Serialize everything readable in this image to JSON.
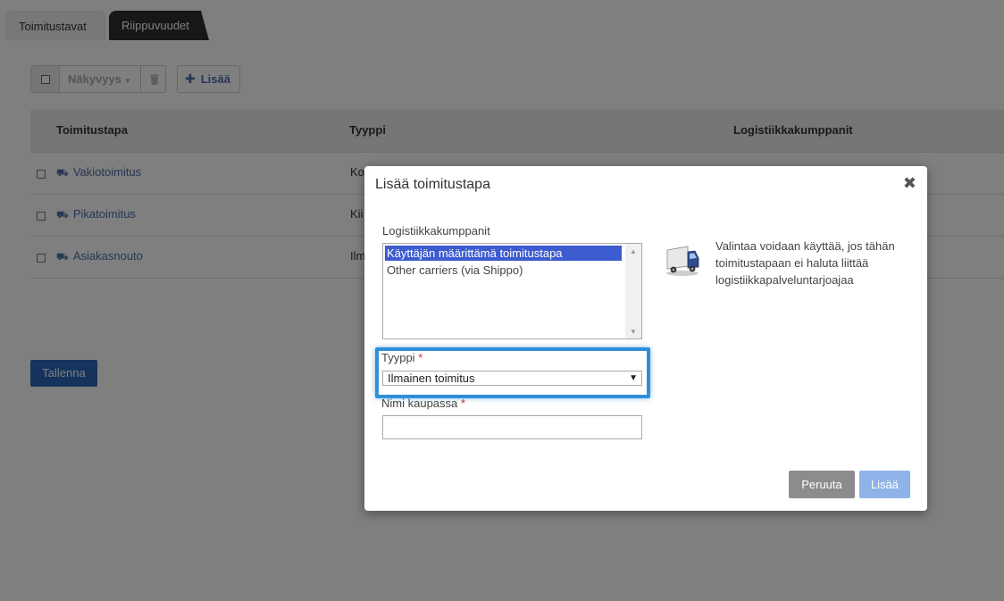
{
  "tabs": [
    {
      "label": "Toimitustavat"
    },
    {
      "label": "Riippuvuudet"
    }
  ],
  "toolbar": {
    "visibility_label": "Näkyvyys",
    "add_label": "Lisää"
  },
  "table": {
    "headers": [
      "Toimitustapa",
      "Tyyppi",
      "Logistiikkakumppanit"
    ],
    "rows": [
      {
        "name": "Vakiotoimitus",
        "type": "Ko"
      },
      {
        "name": "Pikatoimitus",
        "type": "Kii"
      },
      {
        "name": "Asiakasnouto",
        "type": "Ilm"
      }
    ]
  },
  "save_label": "Tallenna",
  "modal": {
    "title": "Lisää toimitustapa",
    "close_symbol": "✖",
    "partners_label": "Logistiikkakumppanit",
    "partners_options": [
      {
        "label": "Käyttäjän määrittämä toimitustapa",
        "selected": true
      },
      {
        "label": "Other carriers (via Shippo)",
        "selected": false
      }
    ],
    "help_text": "Valintaa voidaan käyttää, jos tähän toimitustapaan ei haluta liittää logistiikkapalveluntarjoajaa",
    "type_label": "Tyyppi",
    "type_value": "Ilmainen toimitus",
    "name_label": "Nimi kaupassa",
    "name_value": "",
    "required_marker": "*",
    "cancel_label": "Peruuta",
    "submit_label": "Lisää"
  },
  "colors": {
    "accent": "#2f8fd8",
    "primary_button": "#2a66b8",
    "link": "#4a6fa5",
    "selected_option": "#3d5ccf"
  }
}
